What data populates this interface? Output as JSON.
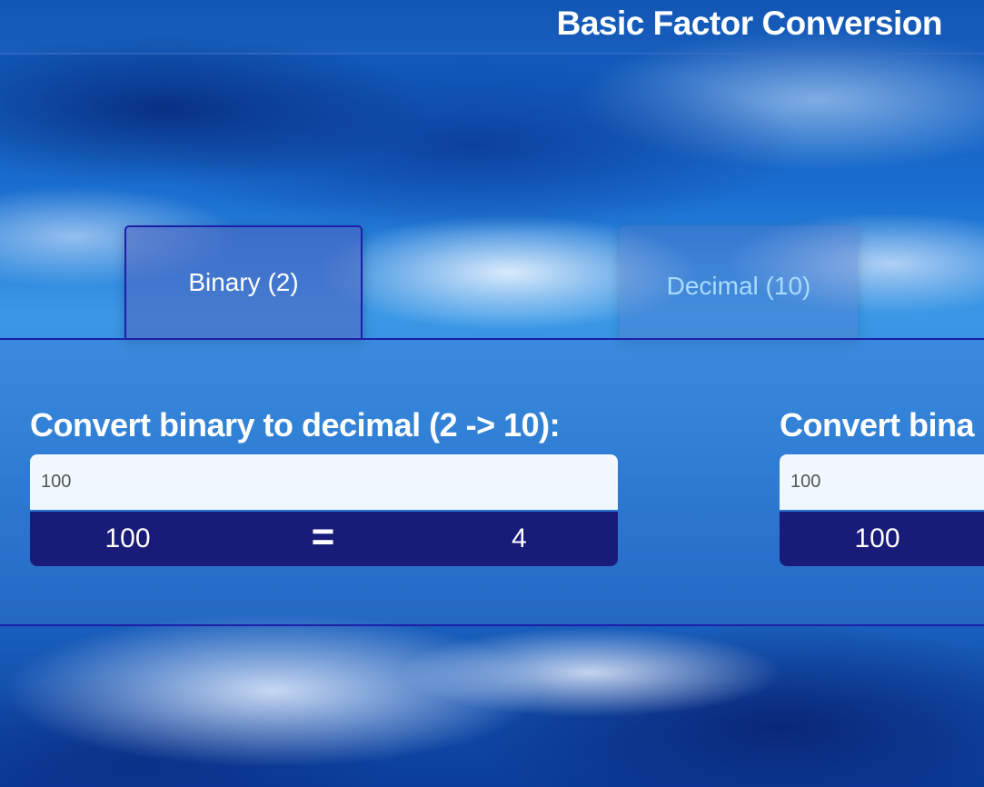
{
  "header": {
    "title": "Basic Factor Conversion"
  },
  "tabs": [
    {
      "label": "Binary (2)",
      "active": true
    },
    {
      "label": "Decimal (10)",
      "active": false
    }
  ],
  "converters": [
    {
      "heading": "Convert binary to decimal (2 -> 10):",
      "input_value": "100",
      "input_placeholder": "100",
      "result_input": "100",
      "equals": "=",
      "result_output": "4"
    },
    {
      "heading": "Convert bina",
      "input_value": "100",
      "input_placeholder": "100",
      "result_input": "100",
      "equals": "=",
      "result_output": ""
    }
  ],
  "colors": {
    "accent": "#1d1fa8",
    "result_bar": "#181b78",
    "inactive_tab_text": "#a8dcff"
  }
}
